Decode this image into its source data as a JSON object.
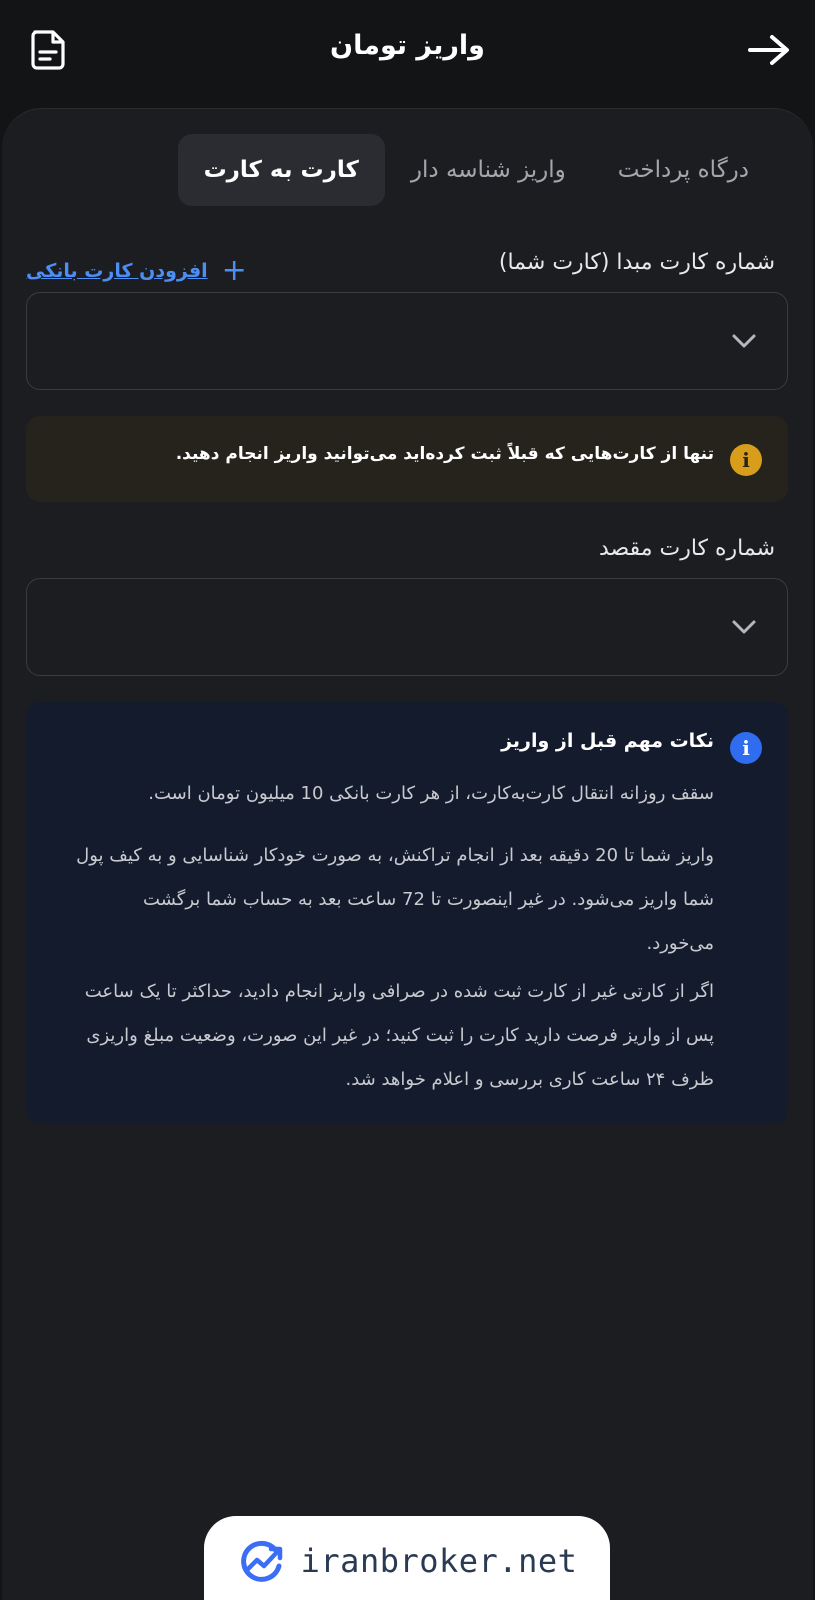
{
  "header": {
    "title": "واریز تومان",
    "back_icon": "arrow-right-icon",
    "history_icon": "document-icon"
  },
  "tabs": [
    {
      "label": "درگاه پرداخت",
      "active": false
    },
    {
      "label": "واریز شناسه دار",
      "active": false
    },
    {
      "label": "کارت به کارت",
      "active": true
    }
  ],
  "source_card": {
    "label": "شماره کارت مبدا (کارت شما)",
    "add_label": "افزودن کارت بانکی",
    "value": ""
  },
  "warning": {
    "text": "تنها از کارت‌هایی که قبلاً ثبت کرده‌اید می‌توانید واریز انجام دهید.",
    "icon": "info-icon",
    "color": "#d89d1a"
  },
  "destination_card": {
    "label": "شماره کارت مقصد",
    "value": ""
  },
  "notes": {
    "title": "نکات مهم قبل از واریز",
    "icon": "info-icon",
    "color": "#2f6cf0",
    "items": [
      "سقف روزانه انتقال کارت‌به‌کارت، از هر کارت بانکی 10 میلیون تومان است.",
      "واریز شما تا 20 دقیقه بعد از انجام تراکنش، به صورت خودکار شناسایی و به کیف پول شما واریز می‌شود. در غیر اینصورت تا 72 ساعت بعد به حساب شما برگشت می‌خورد.",
      "اگر از کارتی غیر از کارت ثبت شده در صرافی واریز انجام دادید، حداکثر تا یک ساعت پس از واریز فرصت دارید کارت را ثبت کنید؛ در غیر این صورت، وضعیت مبلغ واریزی ظرف ۲۴ ساعت کاری بررسی و اعلام خواهد شد."
    ]
  },
  "watermark": {
    "text": "iranbroker.net"
  }
}
